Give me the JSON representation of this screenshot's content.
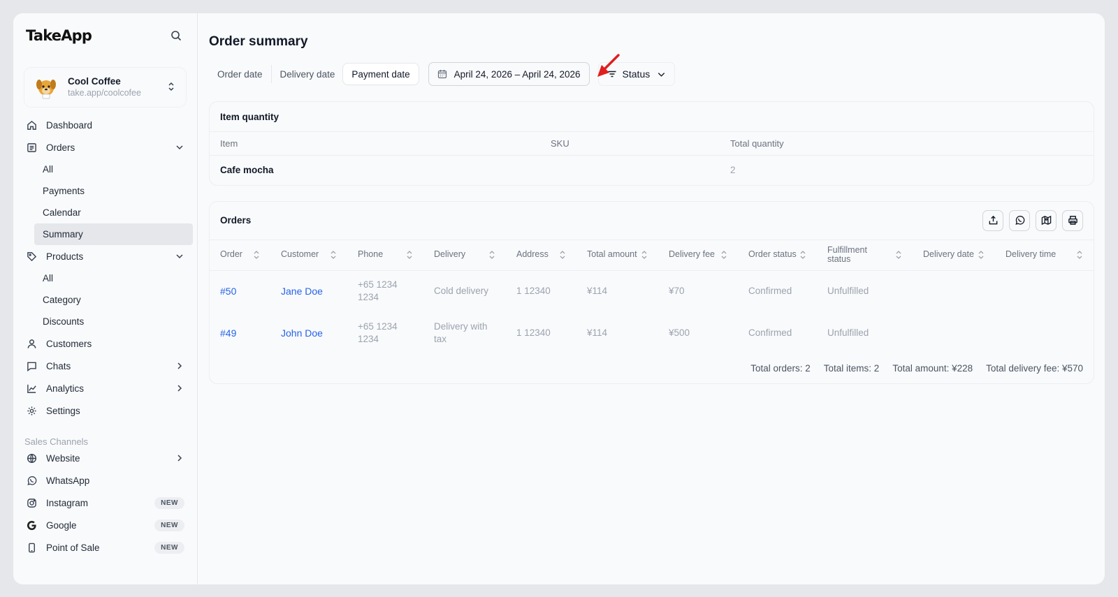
{
  "app": {
    "brand": "TakeApp"
  },
  "store": {
    "name": "Cool Coffee",
    "url": "take.app/coolcofee"
  },
  "nav": {
    "dashboard": "Dashboard",
    "orders": "Orders",
    "orders_sub": [
      "All",
      "Payments",
      "Calendar",
      "Summary"
    ],
    "products": "Products",
    "products_sub": [
      "All",
      "Category",
      "Discounts"
    ],
    "customers": "Customers",
    "chats": "Chats",
    "analytics": "Analytics",
    "settings": "Settings"
  },
  "sales_channels": {
    "label": "Sales Channels",
    "website": "Website",
    "whatsapp": "WhatsApp",
    "instagram": "Instagram",
    "google": "Google",
    "pos": "Point of Sale",
    "new_badge": "NEW"
  },
  "page": {
    "title": "Order summary",
    "date_tabs": [
      "Order date",
      "Delivery date",
      "Payment date"
    ],
    "active_tab": "Payment date",
    "date_range": "April 24, 2026 – April 24, 2026",
    "status_filter": "Status"
  },
  "item_quantity": {
    "title": "Item quantity",
    "columns": [
      "Item",
      "SKU",
      "Total quantity"
    ],
    "rows": [
      {
        "item": "Cafe mocha",
        "sku": "",
        "qty": "2"
      }
    ]
  },
  "orders": {
    "title": "Orders",
    "columns": [
      "Order",
      "Customer",
      "Phone",
      "Delivery",
      "Address",
      "Total amount",
      "Delivery fee",
      "Order status",
      "Fulfillment status",
      "Delivery date",
      "Delivery time"
    ],
    "rows": [
      {
        "order": "#50",
        "customer": "Jane Doe",
        "phone": "+65 1234 1234",
        "delivery": "Cold delivery",
        "address": "1 12340",
        "total": "¥114",
        "fee": "¥70",
        "status": "Confirmed",
        "fulfillment": "Unfulfilled",
        "ddate": "",
        "dtime": ""
      },
      {
        "order": "#49",
        "customer": "John Doe",
        "phone": "+65 1234 1234",
        "delivery": "Delivery with tax",
        "address": "1 12340",
        "total": "¥114",
        "fee": "¥500",
        "status": "Confirmed",
        "fulfillment": "Unfulfilled",
        "ddate": "",
        "dtime": ""
      }
    ],
    "totals": {
      "orders": "Total orders: 2",
      "items": "Total items: 2",
      "amount": "Total amount: ¥228",
      "delivery_fee": "Total delivery fee: ¥570"
    }
  },
  "colors": {
    "link": "#2563eb",
    "annotation_arrow": "#e11d1d"
  }
}
